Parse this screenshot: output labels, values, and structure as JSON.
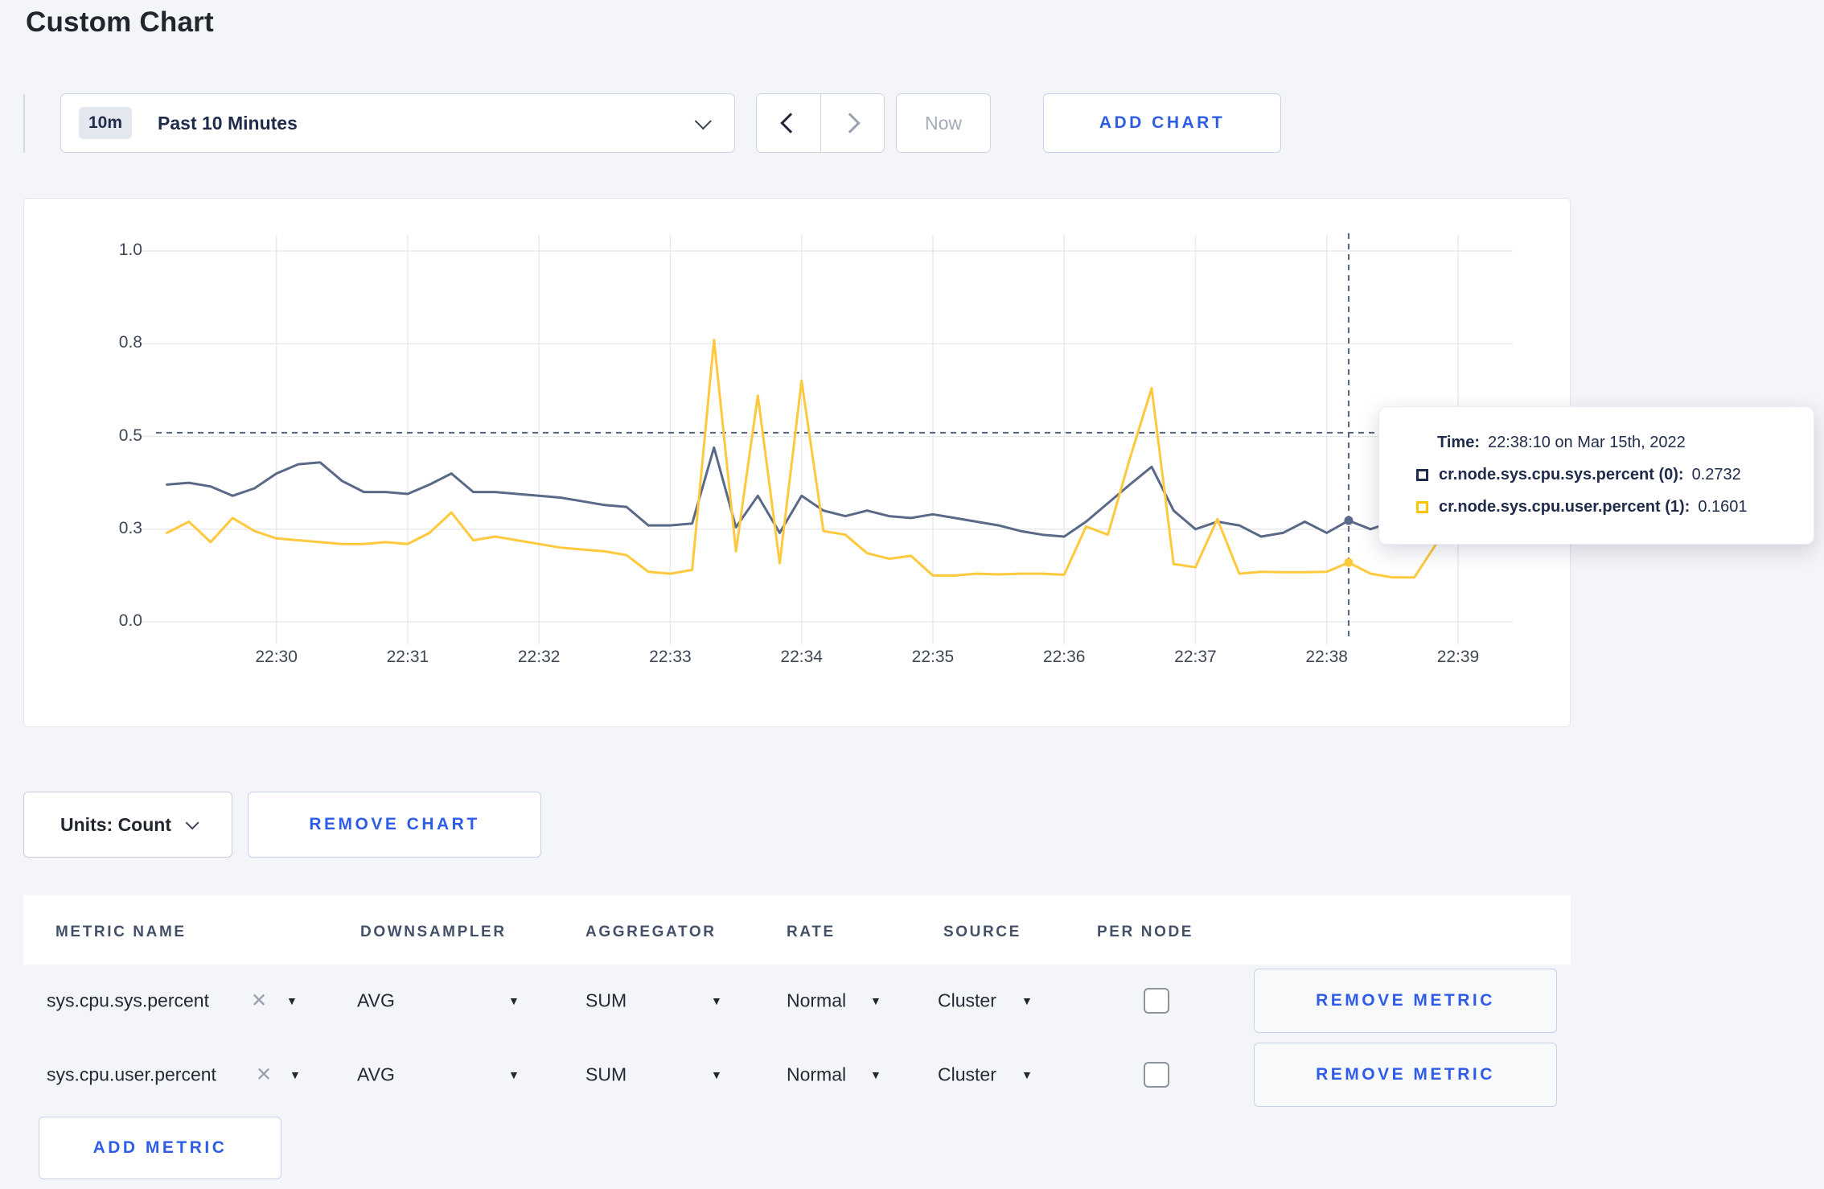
{
  "header": {
    "title": "Custom Chart"
  },
  "toolbar": {
    "range_badge": "10m",
    "range_label": "Past 10 Minutes",
    "now_label": "Now",
    "add_chart_label": "ADD CHART"
  },
  "tooltip": {
    "time_label": "Time:",
    "time_value": "22:38:10 on Mar 15th, 2022",
    "series": [
      {
        "name": "cr.node.sys.cpu.sys.percent (0):",
        "value": "0.2732",
        "color": "#1f2b4a"
      },
      {
        "name": "cr.node.sys.cpu.user.percent (1):",
        "value": "0.1601",
        "color": "#ffc400"
      }
    ]
  },
  "chart_data": {
    "type": "line",
    "title": "",
    "xlabel": "",
    "ylabel": "",
    "ylim": [
      0,
      1
    ],
    "grid": true,
    "x_start": "22:29:10",
    "x_interval_seconds": 10,
    "window_start": "22:29:05",
    "window_seconds": 620,
    "y_ticks": [
      {
        "v": 0,
        "label": "0.0"
      },
      {
        "v": 0.25,
        "label": "0.3"
      },
      {
        "v": 0.5,
        "label": "0.5"
      },
      {
        "v": 0.75,
        "label": "0.8"
      },
      {
        "v": 1,
        "label": "1.0"
      }
    ],
    "x_ticks": [
      "22:30",
      "22:31",
      "22:32",
      "22:33",
      "22:34",
      "22:35",
      "22:36",
      "22:37",
      "22:38",
      "22:39"
    ],
    "crosshair": {
      "index": 54,
      "time": "22:38:10",
      "y_value": 0.51
    },
    "series": [
      {
        "name": "cr.node.sys.cpu.sys.percent",
        "color": "#5a6987",
        "values": [
          0.37,
          0.375,
          0.365,
          0.34,
          0.36,
          0.4,
          0.425,
          0.43,
          0.38,
          0.35,
          0.35,
          0.345,
          0.37,
          0.4,
          0.35,
          0.35,
          0.345,
          0.34,
          0.335,
          0.325,
          0.315,
          0.31,
          0.26,
          0.26,
          0.265,
          0.47,
          0.255,
          0.34,
          0.24,
          0.34,
          0.3,
          0.285,
          0.3,
          0.285,
          0.28,
          0.29,
          0.28,
          0.27,
          0.26,
          0.245,
          0.235,
          0.23,
          0.27,
          0.32,
          0.37,
          0.418,
          0.3,
          0.25,
          0.27,
          0.26,
          0.23,
          0.24,
          0.27,
          0.24,
          0.2732,
          0.25,
          0.27,
          0.3,
          0.31,
          0.3,
          0.305,
          0.3
        ]
      },
      {
        "name": "cr.node.sys.cpu.user.percent",
        "color": "#ffc93e",
        "values": [
          0.24,
          0.27,
          0.215,
          0.28,
          0.245,
          0.225,
          0.22,
          0.215,
          0.21,
          0.21,
          0.215,
          0.21,
          0.24,
          0.295,
          0.22,
          0.23,
          0.22,
          0.21,
          0.2,
          0.195,
          0.19,
          0.18,
          0.135,
          0.13,
          0.14,
          0.76,
          0.19,
          0.61,
          0.158,
          0.65,
          0.245,
          0.235,
          0.185,
          0.17,
          0.178,
          0.125,
          0.125,
          0.13,
          0.128,
          0.13,
          0.13,
          0.127,
          0.257,
          0.235,
          0.44,
          0.63,
          0.156,
          0.147,
          0.277,
          0.13,
          0.135,
          0.134,
          0.134,
          0.135,
          0.1601,
          0.13,
          0.12,
          0.12,
          0.21,
          0.28,
          0.22,
          0.27
        ]
      }
    ]
  },
  "units": {
    "label": "Units: Count"
  },
  "remove_chart_label": "REMOVE CHART",
  "table": {
    "headers": [
      "METRIC NAME",
      "DOWNSAMPLER",
      "AGGREGATOR",
      "RATE",
      "SOURCE",
      "PER NODE"
    ],
    "remove_metric_label": "REMOVE METRIC",
    "rows": [
      {
        "metric": "sys.cpu.sys.percent",
        "downsampler": "AVG",
        "aggregator": "SUM",
        "rate": "Normal",
        "source": "Cluster",
        "per_node": false
      },
      {
        "metric": "sys.cpu.user.percent",
        "downsampler": "AVG",
        "aggregator": "SUM",
        "rate": "Normal",
        "source": "Cluster",
        "per_node": false
      }
    ]
  },
  "add_metric_label": "ADD METRIC",
  "colors": {
    "accent_blue": "#2e5ce6",
    "line_sys": "#5a6987",
    "line_user": "#ffc93e",
    "crosshair": "#54657e"
  }
}
